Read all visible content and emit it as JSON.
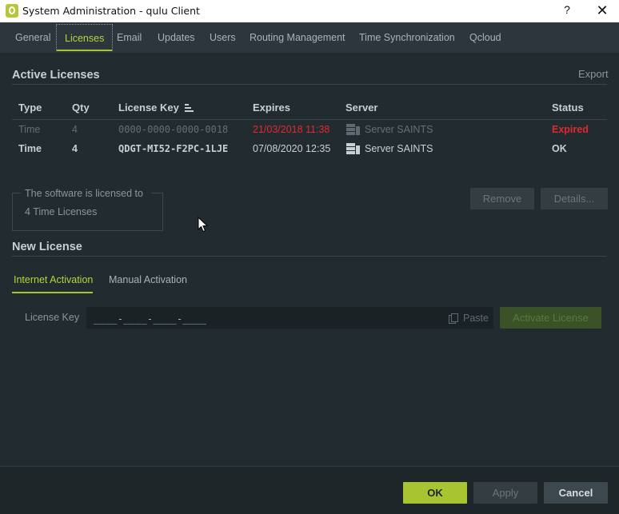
{
  "window": {
    "title": "System Administration - qulu Client",
    "help_label": "?",
    "close_label": "✕"
  },
  "tabs": [
    {
      "label": "General",
      "active": false
    },
    {
      "label": "Licenses",
      "active": true
    },
    {
      "label": "Email",
      "active": false
    },
    {
      "label": "Updates",
      "active": false
    },
    {
      "label": "Users",
      "active": false
    },
    {
      "label": "Routing Management",
      "active": false
    },
    {
      "label": "Time Synchronization",
      "active": false
    },
    {
      "label": "Qcloud",
      "active": false
    }
  ],
  "active_licenses": {
    "title": "Active Licenses",
    "export_label": "Export",
    "columns": [
      "Type",
      "Qty",
      "License Key",
      "Expires",
      "Server",
      "Status"
    ],
    "rows": [
      {
        "type": "Time",
        "qty": "4",
        "key": "0000-0000-0000-0018",
        "expires": "21/03/2018 11:38",
        "server": "Server SAINTS",
        "status": "Expired"
      },
      {
        "type": "Time",
        "qty": "4",
        "key": "QDGT-MI52-F2PC-1LJE",
        "expires": "07/08/2020 12:35",
        "server": "Server SAINTS",
        "status": "OK"
      }
    ],
    "info_legend": "The software is licensed to",
    "info_value": "4 Time Licenses",
    "remove_label": "Remove",
    "details_label": "Details..."
  },
  "new_license": {
    "title": "New License",
    "subtabs": [
      {
        "label": "Internet Activation",
        "active": true
      },
      {
        "label": "Manual Activation",
        "active": false
      }
    ],
    "field_label": "License Key",
    "field_value": "____-____-____-____",
    "paste_label": "Paste",
    "activate_label": "Activate License"
  },
  "footer": {
    "ok_label": "OK",
    "apply_label": "Apply",
    "cancel_label": "Cancel"
  },
  "colors": {
    "accent": "#a8c431",
    "expired": "#e0292e",
    "background": "#222b30"
  }
}
